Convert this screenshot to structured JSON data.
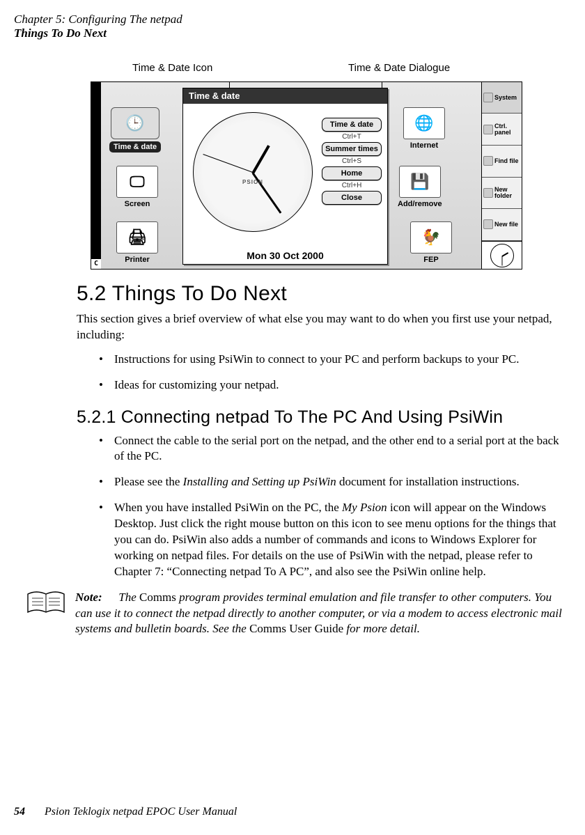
{
  "header": {
    "chapter": "Chapter 5:  Configuring The netpad",
    "section": "Things To Do Next"
  },
  "annotations": {
    "left": "Time & Date Icon",
    "right": "Time & Date Dialogue"
  },
  "screenshot": {
    "corner": "C",
    "desk": {
      "timedate": "Time & date",
      "screen": "Screen",
      "printer": "Printer",
      "internet": "Internet",
      "addremove": "Add/remove",
      "fep": "FEP"
    },
    "dialog": {
      "title": "Time & date",
      "date": "Mon 30 Oct 2000",
      "brand": "PSION",
      "buttons": {
        "timedate": "Time & date",
        "sc_timedate": "Ctrl+T",
        "summer": "Summer times",
        "sc_summer": "Ctrl+S",
        "home": "Home",
        "sc_home": "Ctrl+H",
        "close": "Close"
      }
    },
    "rightcol": {
      "system": "System",
      "ctrlpanel": "Ctrl. panel",
      "findfile": "Find file",
      "newfolder": "New folder",
      "newfile": "New file"
    }
  },
  "sections": {
    "s52_title": "5.2   Things To Do Next",
    "s52_intro": "This section gives a brief overview of what else you may want to do when you first use your netpad, including:",
    "s52_b1": "Instructions for using PsiWin to connect to your PC and perform backups to your PC.",
    "s52_b2": "Ideas for customizing your netpad.",
    "s521_title": "5.2.1   Connecting netpad To The PC And Using PsiWin",
    "s521_b1": "Connect the cable to the serial port on the netpad, and the other end to a serial port at the back of the PC.",
    "s521_b2a": "Please see the ",
    "s521_b2_em": "Installing and Setting up PsiWin",
    "s521_b2b": " document for installation instructions.",
    "s521_b3a": "When you have installed PsiWin on the PC, the ",
    "s521_b3_em": "My Psion",
    "s521_b3b": " icon will appear on the Windows Desktop. Just click the right mouse button on this icon to see menu options for the things that you can do. PsiWin also adds a number of commands and icons to Windows Explorer for working on netpad files. For details on the use of PsiWin with the netpad, please refer to Chapter 7: “Connecting netpad To A PC”, and also see the PsiWin online help."
  },
  "note": {
    "label": "Note:",
    "t1": "The ",
    "u1": "Comms",
    "t2": " program provides terminal emulation and file transfer to other computers. You can use it to connect the netpad directly to another computer, or via a modem to access electronic mail systems and bulletin boards. See the ",
    "u2": "Comms User Guide",
    "t3": " for more detail."
  },
  "footer": {
    "page": "54",
    "book": "Psion Teklogix netpad EPOC User Manual"
  }
}
